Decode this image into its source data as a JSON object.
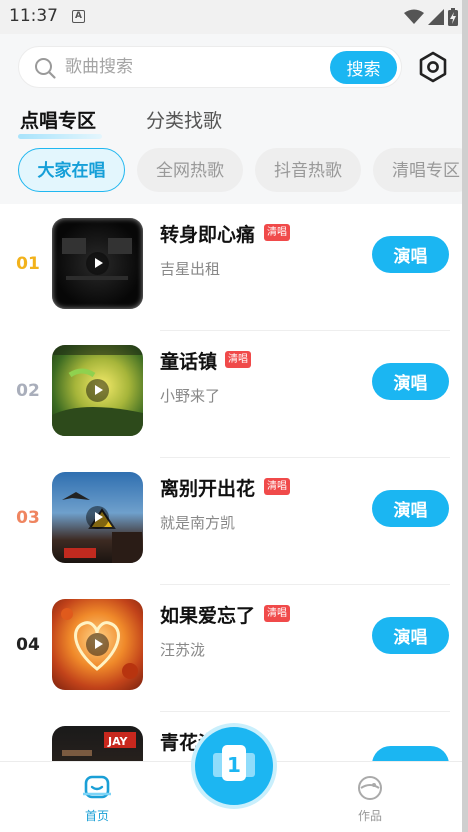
{
  "status_bar": {
    "time": "11:37",
    "notification_glyph": "A"
  },
  "search": {
    "placeholder": "歌曲搜索",
    "button_label": "搜索"
  },
  "main_tabs": [
    {
      "label": "点唱专区",
      "active": true
    },
    {
      "label": "分类找歌",
      "active": false
    }
  ],
  "chips": [
    {
      "label": "大家在唱",
      "active": true
    },
    {
      "label": "全网热歌",
      "active": false
    },
    {
      "label": "抖音热歌",
      "active": false
    },
    {
      "label": "清唱专区",
      "active": false
    }
  ],
  "songs": [
    {
      "rank": "01",
      "rank_color": "#f2b21c",
      "title": "转身即心痛",
      "tag": "清唱",
      "artist": "吉星出租",
      "action": "演唱"
    },
    {
      "rank": "02",
      "rank_color": "#a9aebb",
      "title": "童话镇",
      "tag": "清唱",
      "artist": "小野来了",
      "action": "演唱"
    },
    {
      "rank": "03",
      "rank_color": "#ef8560",
      "title": "离别开出花",
      "tag": "清唱",
      "artist": "就是南方凯",
      "action": "演唱"
    },
    {
      "rank": "04",
      "rank_color": "#222222",
      "title": "如果爱忘了",
      "tag": "清唱",
      "artist": "汪苏泷",
      "action": "演唱"
    },
    {
      "rank": "",
      "rank_color": "#222222",
      "title": "青花瓷",
      "tag": "",
      "artist": "",
      "action": ""
    }
  ],
  "bottom_nav": {
    "home_label": "首页",
    "works_label": "作品",
    "center_label": "1"
  },
  "colors": {
    "accent": "#1bb6f2",
    "tag": "#f04a4a"
  }
}
